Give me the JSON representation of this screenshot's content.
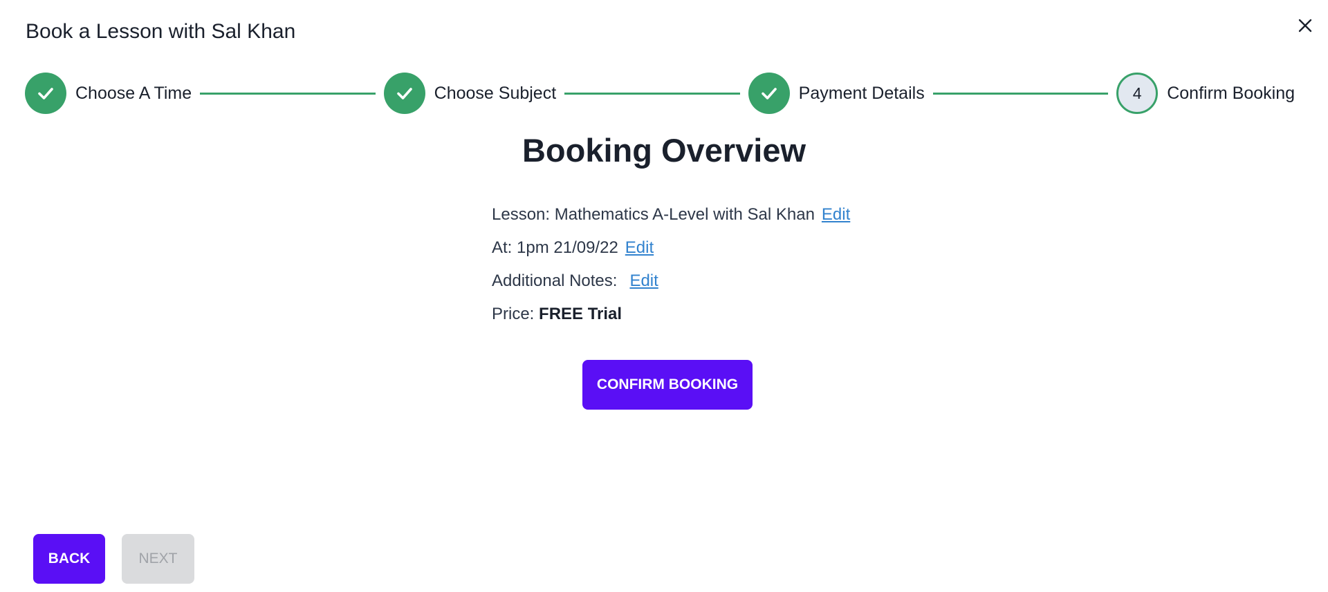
{
  "modal": {
    "title": "Book a Lesson with Sal Khan",
    "close_icon": "close-icon"
  },
  "stepper": {
    "accent_color": "#38a169",
    "steps": [
      {
        "label": "Choose A Time",
        "status": "complete",
        "icon": "check-icon"
      },
      {
        "label": "Choose Subject",
        "status": "complete",
        "icon": "check-icon"
      },
      {
        "label": "Payment Details",
        "status": "complete",
        "icon": "check-icon"
      },
      {
        "label": "Confirm Booking",
        "status": "current",
        "number": "4"
      }
    ]
  },
  "overview": {
    "title": "Booking Overview",
    "lesson_label": "Lesson: Mathematics A-Level with Sal Khan",
    "time_label": "At: 1pm 21/09/22",
    "notes_label": "Additional Notes:",
    "price_label": "Price:",
    "price_value": "FREE Trial",
    "edit_label": "Edit"
  },
  "actions": {
    "confirm_label": "CONFIRM BOOKING",
    "back_label": "BACK",
    "next_label": "NEXT",
    "primary_color": "#5a0ff5"
  }
}
